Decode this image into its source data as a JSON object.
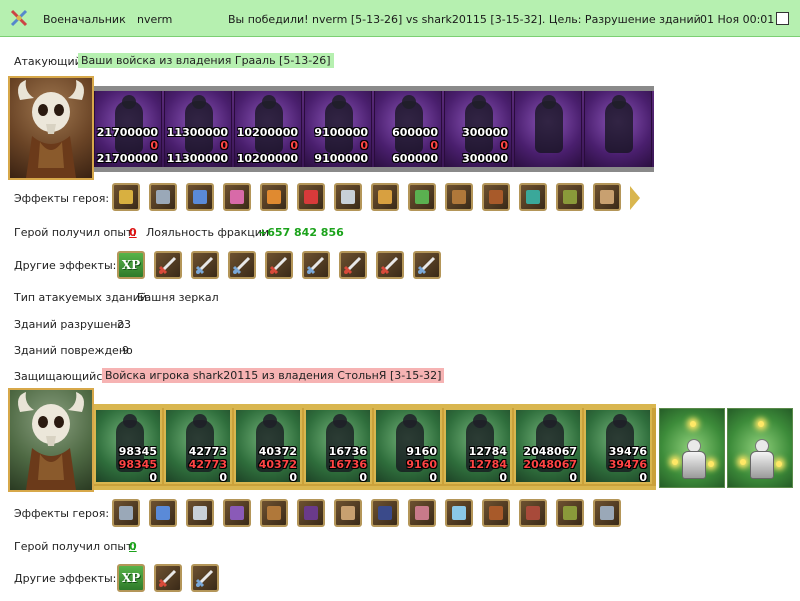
{
  "header": {
    "icon": "crossed-swords-icon",
    "role": "Военачальник",
    "player": "nverm",
    "message": "Вы победили! nverm [5-13-26] vs shark20115 [3-15-32]. Цель: Разрушение зданий",
    "time": "01 Ноя 00:01"
  },
  "attacker": {
    "label": "Атакующий",
    "title": "Ваши войска из владения Грааль [5-13-26]",
    "portrait": "barbarian-skull-helm-portrait",
    "units": [
      {
        "name": "unit-1",
        "n1": "21700000",
        "n2": "0",
        "n3": "21700000"
      },
      {
        "name": "unit-2",
        "n1": "11300000",
        "n2": "0",
        "n3": "11300000"
      },
      {
        "name": "unit-3",
        "n1": "10200000",
        "n2": "0",
        "n3": "10200000"
      },
      {
        "name": "unit-4",
        "n1": "9100000",
        "n2": "0",
        "n3": "9100000"
      },
      {
        "name": "unit-5",
        "n1": "600000",
        "n2": "0",
        "n3": "600000"
      },
      {
        "name": "unit-6",
        "n1": "300000",
        "n2": "0",
        "n3": "300000"
      },
      {
        "name": "unit-7",
        "n1": "",
        "n2": "",
        "n3": ""
      },
      {
        "name": "unit-8",
        "n1": "",
        "n2": "",
        "n3": ""
      }
    ],
    "hero_effects_label": "Эффекты героя:",
    "hero_effects": [
      "gold",
      "steel",
      "blue",
      "pink",
      "orange",
      "red",
      "silver",
      "amber",
      "green",
      "bronze",
      "rust",
      "teal",
      "olive",
      "tan"
    ],
    "exp_label": "Герой получил опыт:",
    "exp_value": "0",
    "loyalty_label": "Лояльность фракции",
    "loyalty_value": "+657 842 856",
    "other_effects_label": "Другие эффекты:",
    "other_effects": [
      "XP",
      "sword-red",
      "sword-blue",
      "sword-blue",
      "sword-red",
      "sword-blue",
      "sword-red",
      "sword-red",
      "sword-blue"
    ],
    "building_type_label": "Тип атакуемых зданий",
    "building_type_value": "Башня зеркал",
    "destroyed_label": "Зданий разрушено",
    "destroyed_value": "23",
    "damaged_label": "Зданий повреждено",
    "damaged_value": "9"
  },
  "defender": {
    "label": "Защищающийся",
    "title": "Войска игрока shark20115 из владения СтольнЯ [3-15-32]",
    "portrait": "barbarian-skull-helm-portrait",
    "units": [
      {
        "name": "unit-1",
        "n1": "98345",
        "n2": "98345",
        "n3": "0"
      },
      {
        "name": "unit-2",
        "n1": "42773",
        "n2": "42773",
        "n3": "0"
      },
      {
        "name": "unit-3",
        "n1": "40372",
        "n2": "40372",
        "n3": "0"
      },
      {
        "name": "unit-4",
        "n1": "16736",
        "n2": "16736",
        "n3": "0"
      },
      {
        "name": "unit-5",
        "n1": "9160",
        "n2": "9160",
        "n3": "0"
      },
      {
        "name": "unit-6",
        "n1": "12784",
        "n2": "12784",
        "n3": "0"
      },
      {
        "name": "unit-7",
        "n1": "2048067",
        "n2": "2048067",
        "n3": "0"
      },
      {
        "name": "unit-8",
        "n1": "39476",
        "n2": "39476",
        "n3": "0"
      }
    ],
    "hero_effects_label": "Эффекты героя:",
    "hero_effects": [
      "steel",
      "blue",
      "silver",
      "violet",
      "bronze",
      "purple",
      "tan",
      "navy",
      "rose",
      "ice",
      "rust",
      "brick",
      "olive",
      "steel"
    ],
    "exp_label": "Герой получил опыт:",
    "exp_value": "0",
    "other_effects_label": "Другие эффекты:",
    "other_effects": [
      "XP",
      "sword-red",
      "sword-blue"
    ]
  },
  "colors": {
    "header_bg": "#b6f0b0",
    "attacker_highlight": "#b6f0b0",
    "defender_highlight": "#f6b3b3",
    "loss": "#ff4444",
    "gain": "#1ca31c"
  }
}
